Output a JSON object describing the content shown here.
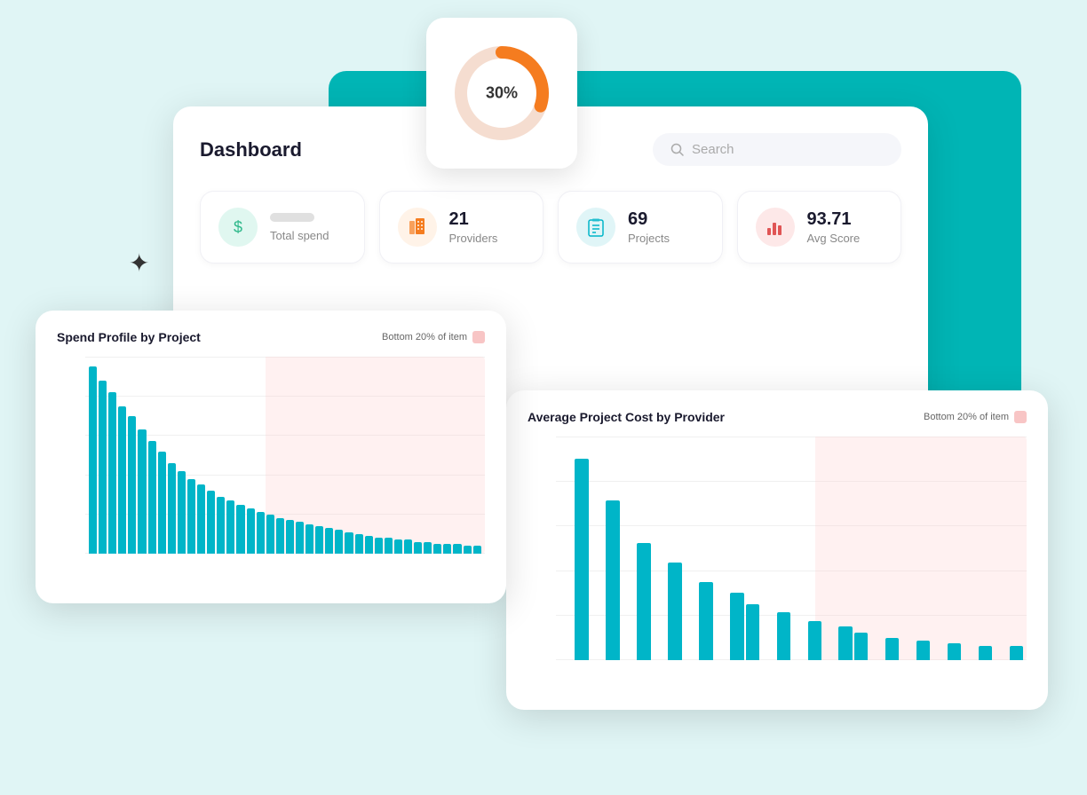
{
  "background": {
    "color1": "#00c2c2",
    "color2": "#00a8a8"
  },
  "donut": {
    "percent": 30,
    "label": "30%",
    "color_fill": "#f57c1f",
    "color_track": "#f5ddd0"
  },
  "dashboard": {
    "title": "Dashboard",
    "search_placeholder": "Search"
  },
  "stats": [
    {
      "id": "total-spend",
      "label": "Total spend",
      "value": "",
      "icon": "$",
      "icon_type": "green",
      "loading": true
    },
    {
      "id": "providers",
      "label": "Providers",
      "value": "21",
      "icon": "⊞",
      "icon_type": "orange",
      "loading": false
    },
    {
      "id": "projects",
      "label": "Projects",
      "value": "69",
      "icon": "📋",
      "icon_type": "teal",
      "loading": false
    },
    {
      "id": "avg-score",
      "label": "Avg Score",
      "value": "93.71",
      "icon": "📊",
      "icon_type": "pink",
      "loading": false
    }
  ],
  "chart1": {
    "title": "Spend Profile by Project",
    "legend_label": "Bottom 20% of item",
    "y_labels": [
      "",
      "",
      "",
      "",
      "",
      ""
    ],
    "pink_start_percent": 45,
    "bars": [
      95,
      88,
      82,
      75,
      70,
      63,
      57,
      52,
      46,
      42,
      38,
      35,
      32,
      29,
      27,
      25,
      23,
      21,
      20,
      18,
      17,
      16,
      15,
      14,
      13,
      12,
      11,
      10,
      9,
      8,
      8,
      7,
      7,
      6,
      6,
      5,
      5,
      5,
      4,
      4
    ]
  },
  "chart2": {
    "title": "Average Project Cost by Provider",
    "legend_label": "Bottom 20% of item",
    "y_labels": [
      "",
      "",
      "",
      "",
      "",
      ""
    ],
    "pink_start_percent": 55,
    "bars": [
      0,
      72,
      0,
      57,
      0,
      42,
      0,
      35,
      0,
      28,
      0,
      24,
      20,
      0,
      17,
      0,
      14,
      0,
      12,
      10,
      0,
      8,
      0,
      7,
      0,
      6,
      0,
      5,
      0,
      5
    ]
  },
  "spark": {
    "symbol": "✦"
  }
}
